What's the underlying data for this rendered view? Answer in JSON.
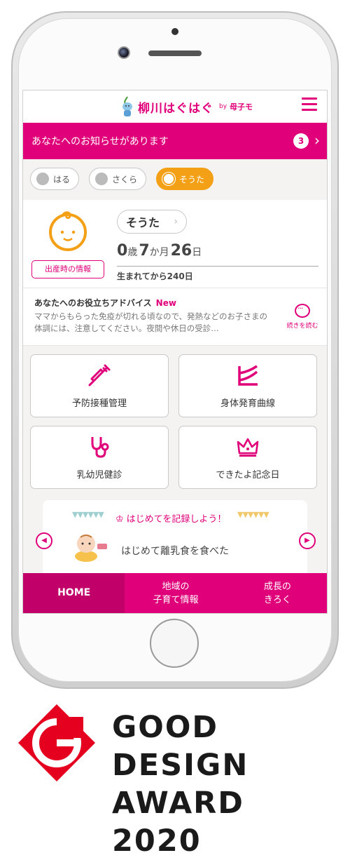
{
  "header": {
    "logo_title": "柳川はぐはぐ",
    "logo_by": "by",
    "logo_brand": "母子モ"
  },
  "notice": {
    "text": "あなたへのお知らせがあります",
    "count": "3"
  },
  "children": [
    {
      "name": "はる",
      "active": false
    },
    {
      "name": "さくら",
      "active": false
    },
    {
      "name": "そうた",
      "active": true
    }
  ],
  "profile": {
    "birth_info_label": "出産時の情報",
    "name": "そうた",
    "age_years": "0",
    "age_years_unit": "歳",
    "age_months": "7",
    "age_months_unit": "か月",
    "age_days": "26",
    "age_days_unit": "日",
    "days_since_birth": "生まれてから240日"
  },
  "advice": {
    "title": "あなたへのお役立ちアドバイス",
    "badge": "New",
    "body": "ママからもらった免疫が切れる頃なので、発熱などのお子さまの体調には、注意してください。夜間や休日の受診…",
    "more_label": "続きを読む"
  },
  "menu_tiles": [
    {
      "label": "予防接種管理",
      "icon": "syringe-icon"
    },
    {
      "label": "身体発育曲線",
      "icon": "growth-chart-icon"
    },
    {
      "label": "乳幼児健診",
      "icon": "stethoscope-icon"
    },
    {
      "label": "できたよ記念日",
      "icon": "crown-icon"
    }
  ],
  "carousel": {
    "title": "はじめてを記録しよう！",
    "item_text": "はじめて離乳食を食べた"
  },
  "bottom_nav": [
    {
      "label": "HOME",
      "active": true
    },
    {
      "label": "地域の\n子育て情報",
      "active": false
    },
    {
      "label": "成長の\nきろく",
      "active": false
    }
  ],
  "award": {
    "line1": "GOOD DESIGN",
    "line2": "AWARD 2020"
  },
  "colors": {
    "accent": "#e0007a",
    "accent_dark": "#c2006a",
    "active_child": "#f4a016"
  }
}
